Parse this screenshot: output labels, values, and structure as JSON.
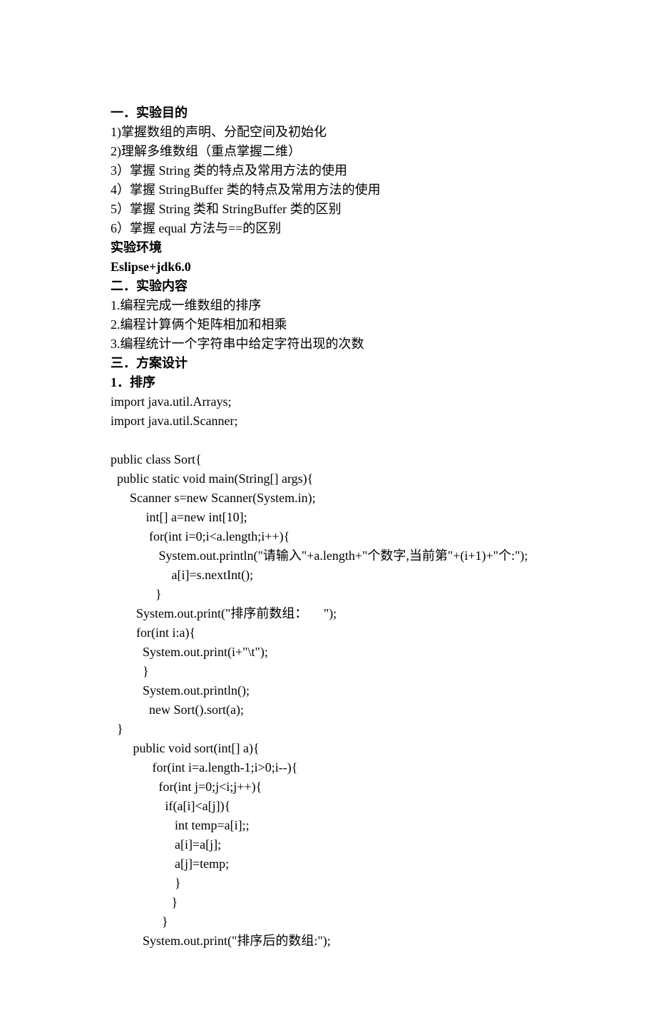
{
  "lines": [
    {
      "text": "一．实验目的",
      "bold": true
    },
    {
      "text": "1)掌握数组的声明、分配空间及初始化"
    },
    {
      "text": "2)理解多维数组（重点掌握二维）"
    },
    {
      "text": "3）掌握 String 类的特点及常用方法的使用"
    },
    {
      "text": "4）掌握 StringBuffer 类的特点及常用方法的使用"
    },
    {
      "text": "5）掌握 String 类和 StringBuffer 类的区别"
    },
    {
      "text": "6）掌握 equal 方法与==的区别"
    },
    {
      "text": "实验环境",
      "bold": true
    },
    {
      "text": "Eslipse+jdk6.0",
      "bold": true
    },
    {
      "text": "二．实验内容",
      "bold": true
    },
    {
      "text": "1.编程完成一维数组的排序"
    },
    {
      "text": "2.编程计算俩个矩阵相加和相乘"
    },
    {
      "text": "3.编程统计一个字符串中给定字符出现的次数"
    },
    {
      "text": "三．方案设计",
      "bold": true
    },
    {
      "text": "1．排序",
      "bold": true
    },
    {
      "text": "import java.util.Arrays;"
    },
    {
      "text": "import java.util.Scanner;"
    },
    {
      "text": ""
    },
    {
      "text": "public class Sort{"
    },
    {
      "text": "  public static void main(String[] args){"
    },
    {
      "text": "      Scanner s=new Scanner(System.in);"
    },
    {
      "text": "           int[] a=new int[10];"
    },
    {
      "text": "            for(int i=0;i<a.length;i++){"
    },
    {
      "text": "               System.out.println(\"请输入\"+a.length+\"个数字,当前第\"+(i+1)+\"个:\");"
    },
    {
      "text": "                   a[i]=s.nextInt();"
    },
    {
      "text": "              }"
    },
    {
      "text": "        System.out.print(\"排序前数组：     \");"
    },
    {
      "text": "        for(int i:a){"
    },
    {
      "text": "          System.out.print(i+\"\\t\");"
    },
    {
      "text": "          }"
    },
    {
      "text": "          System.out.println();"
    },
    {
      "text": "            new Sort().sort(a);"
    },
    {
      "text": "  }"
    },
    {
      "text": "       public void sort(int[] a){"
    },
    {
      "text": "             for(int i=a.length-1;i>0;i--){"
    },
    {
      "text": "               for(int j=0;j<i;j++){"
    },
    {
      "text": "                 if(a[i]<a[j]){"
    },
    {
      "text": "                    int temp=a[i];;"
    },
    {
      "text": "                    a[i]=a[j];"
    },
    {
      "text": "                    a[j]=temp;"
    },
    {
      "text": "                    }"
    },
    {
      "text": "                   }"
    },
    {
      "text": "                }"
    },
    {
      "text": "          System.out.print(\"排序后的数组:\");"
    }
  ]
}
